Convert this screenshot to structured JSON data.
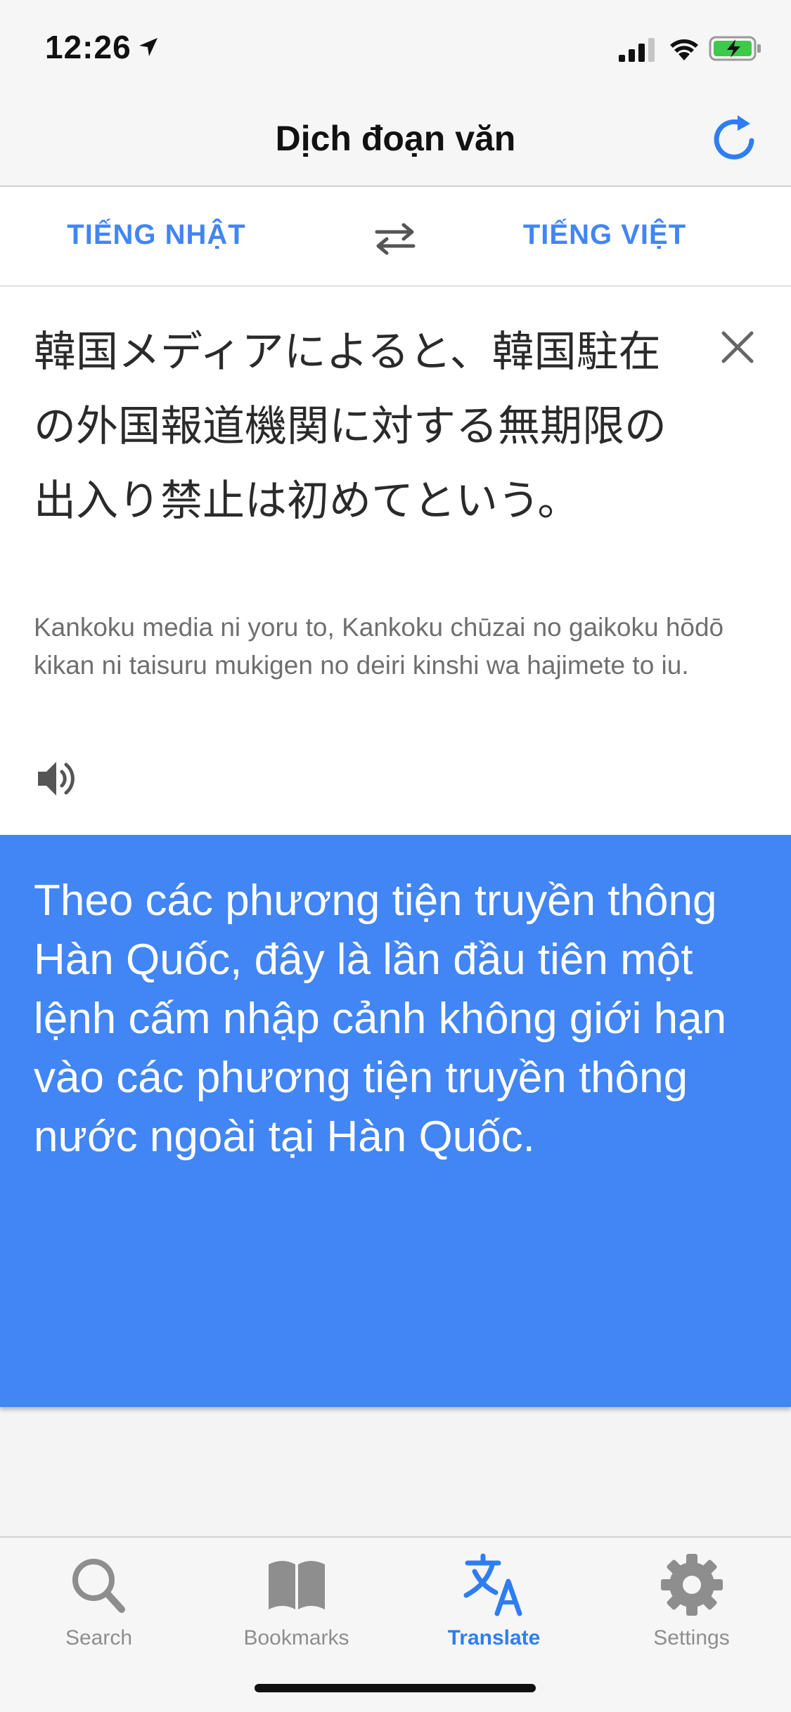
{
  "status_bar": {
    "time": "12:26"
  },
  "nav": {
    "title": "Dịch đoạn văn"
  },
  "languages": {
    "source": "TIẾNG NHẬT",
    "target": "TIẾNG VIỆT"
  },
  "source": {
    "text": "韓国メディアによると、韓国駐在の外国報道機関に対する無期限の出入り禁止は初めてという。",
    "romanization": "Kankoku media ni yoru to, Kankoku chūzai no gaikoku hōdō kikan ni taisuru mukigen no deiri kinshi wa hajimete to iu."
  },
  "translation": {
    "text": "Theo các phương tiện truyền thông Hàn Quốc, đây là lần đầu tiên một lệnh cấm nhập cảnh không giới hạn vào các phương tiện truyền thông nước ngoài tại Hàn Quốc."
  },
  "tabs": [
    {
      "label": "Search",
      "icon": "search-icon"
    },
    {
      "label": "Bookmarks",
      "icon": "book-icon"
    },
    {
      "label": "Translate",
      "icon": "translate-icon",
      "active": true
    },
    {
      "label": "Settings",
      "icon": "gear-icon"
    }
  ],
  "colors": {
    "accent": "#4285f4",
    "active_tab": "#2f7ef0",
    "inactive_tab": "#8e8e8e"
  }
}
